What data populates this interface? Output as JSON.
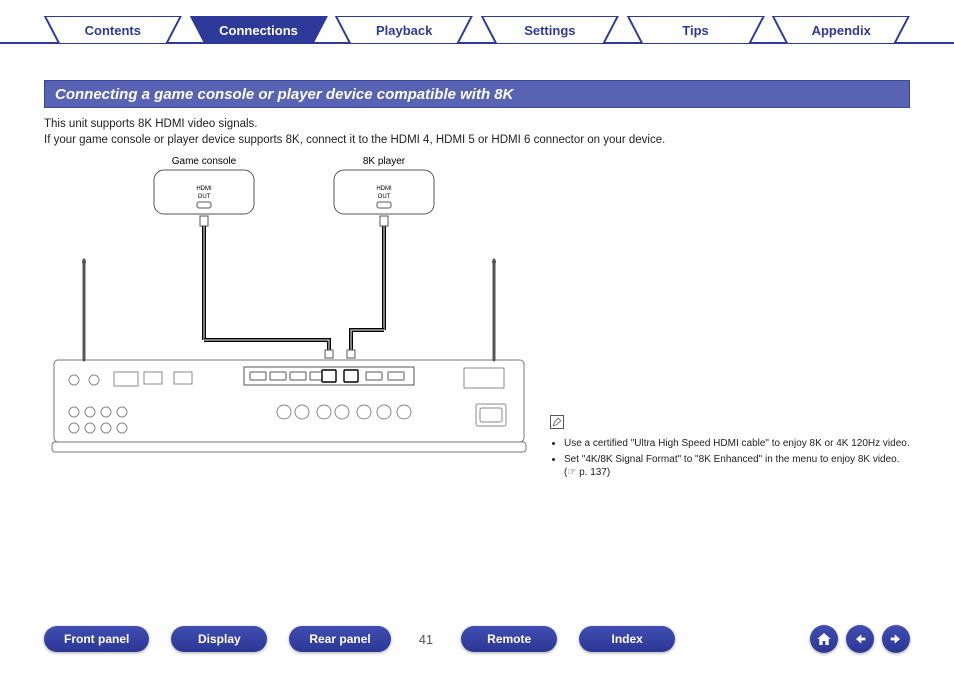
{
  "tabs": {
    "items": [
      {
        "label": "Contents",
        "active": false
      },
      {
        "label": "Connections",
        "active": true
      },
      {
        "label": "Playback",
        "active": false
      },
      {
        "label": "Settings",
        "active": false
      },
      {
        "label": "Tips",
        "active": false
      },
      {
        "label": "Appendix",
        "active": false
      }
    ]
  },
  "title": "Connecting a game console or player device compatible with 8K",
  "body": {
    "line1": "This unit supports 8K HDMI video signals.",
    "line2": "If your game console or player device supports 8K, connect it to the HDMI 4, HDMI 5 or HDMI 6 connector on your device."
  },
  "diagram": {
    "device_left_label": "Game console",
    "device_right_label": "8K player",
    "hdmi_out_text": "HDMI",
    "hdmi_out_sub": "OUT"
  },
  "note": {
    "pencil_icon_name": "pencil-icon",
    "items": [
      "Use a certified \"Ultra High Speed HDMI cable\" to enjoy 8K or 4K 120Hz video.",
      "Set \"4K/8K Signal Format\" to \"8K Enhanced\" in the menu to enjoy 8K video.  (☞ p. 137)"
    ]
  },
  "bottom": {
    "pills": [
      "Front panel",
      "Display",
      "Rear panel"
    ],
    "page_number": "41",
    "pills2": [
      "Remote",
      "Index"
    ],
    "icons": [
      "home-icon",
      "arrow-left-icon",
      "arrow-right-icon"
    ]
  }
}
